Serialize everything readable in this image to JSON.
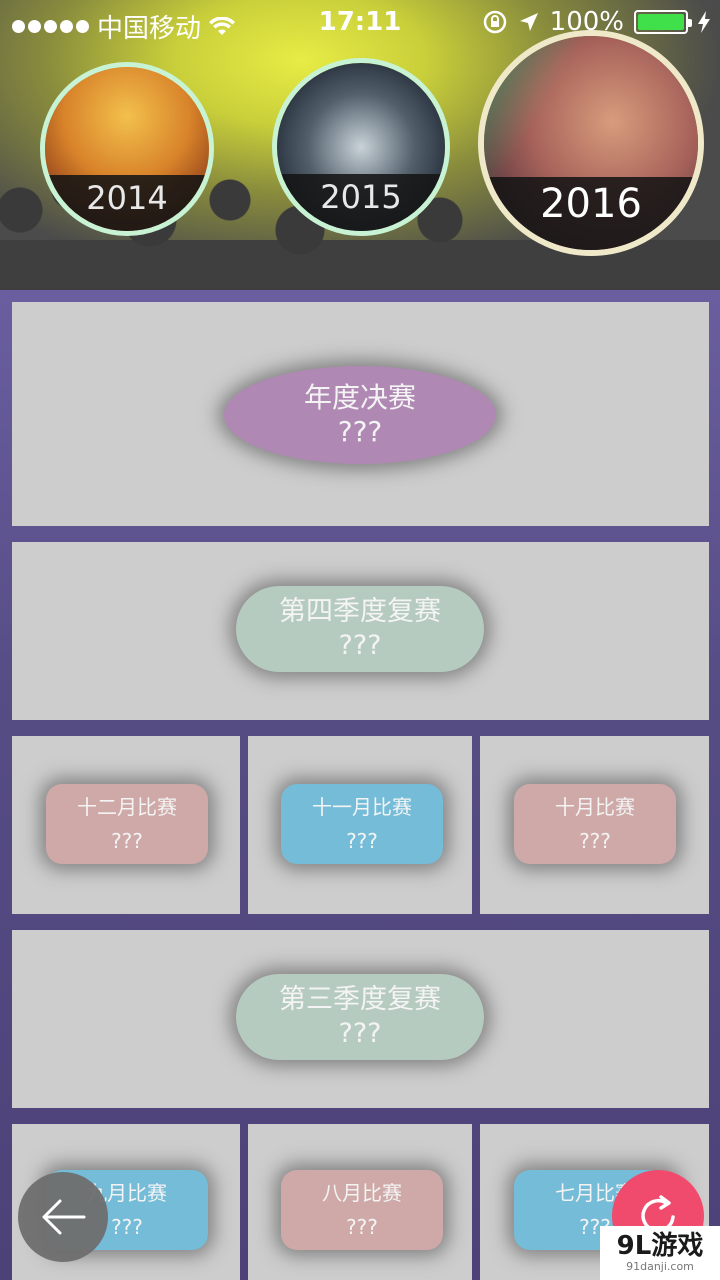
{
  "status_bar": {
    "carrier": "中国移动",
    "time": "17:11",
    "battery_percent": "100%",
    "battery_color": "#3fe04a"
  },
  "years": [
    {
      "label": "2014"
    },
    {
      "label": "2015"
    },
    {
      "label": "2016"
    }
  ],
  "contests": {
    "annual_final": {
      "title": "年度决赛",
      "value": "???"
    },
    "q4_rematch": {
      "title": "第四季度复赛",
      "value": "???"
    },
    "row1": [
      {
        "title": "十二月比赛",
        "value": "???",
        "color": "#cea9a8"
      },
      {
        "title": "十一月比赛",
        "value": "???",
        "color": "#74bcd8"
      },
      {
        "title": "十月比赛",
        "value": "???",
        "color": "#cea9a8"
      }
    ],
    "q3_rematch": {
      "title": "第三季度复赛",
      "value": "???"
    },
    "row2": [
      {
        "title": "九月比赛",
        "value": "???",
        "color": "#74bcd8"
      },
      {
        "title": "八月比赛",
        "value": "???",
        "color": "#cea9a8"
      },
      {
        "title": "七月比赛",
        "value": "???",
        "color": "#74bcd8"
      }
    ]
  },
  "controls": {
    "back_icon": "arrow-left-icon",
    "refresh_icon": "refresh-icon",
    "refresh_color": "#f04a6c"
  },
  "watermark": {
    "brand": "9L游戏",
    "url": "91danji.com"
  }
}
